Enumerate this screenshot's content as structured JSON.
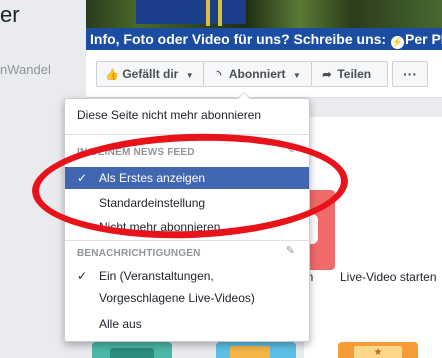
{
  "page": {
    "title_fragment": "er",
    "subtitle_fragment": "nWandel"
  },
  "cover": {
    "banner_text_before": "Info, Foto oder Video für uns? Schreibe uns:",
    "banner_text_after": "Per PN"
  },
  "actions": {
    "like_label": "Gefällt dir",
    "follow_label": "Abonniert",
    "share_label": "Teilen",
    "more_label": "···"
  },
  "menu": {
    "unfollow_page": "Diese Seite nicht mehr abonnieren",
    "news_feed_heading": "IN DEINEM NEWS FEED",
    "see_first": "Als Erstes anzeigen",
    "default": "Standardeinstellung",
    "unfollow": "Nicht mehr abonnieren",
    "notifications_heading": "BENACHRICHTIGUNGEN",
    "notif_on_line1": "Ein (Veranstaltungen,",
    "notif_on_line2": "Vorgeschlagene Live-Videos)",
    "all_off": "Alle aus"
  },
  "tiles": {
    "live_video_label": "Live-Video starten",
    "partial_label": "en"
  },
  "colors": {
    "selected_bg": "#4267b2",
    "annotation": "#e8121a",
    "banner": "#1b4ea3"
  }
}
